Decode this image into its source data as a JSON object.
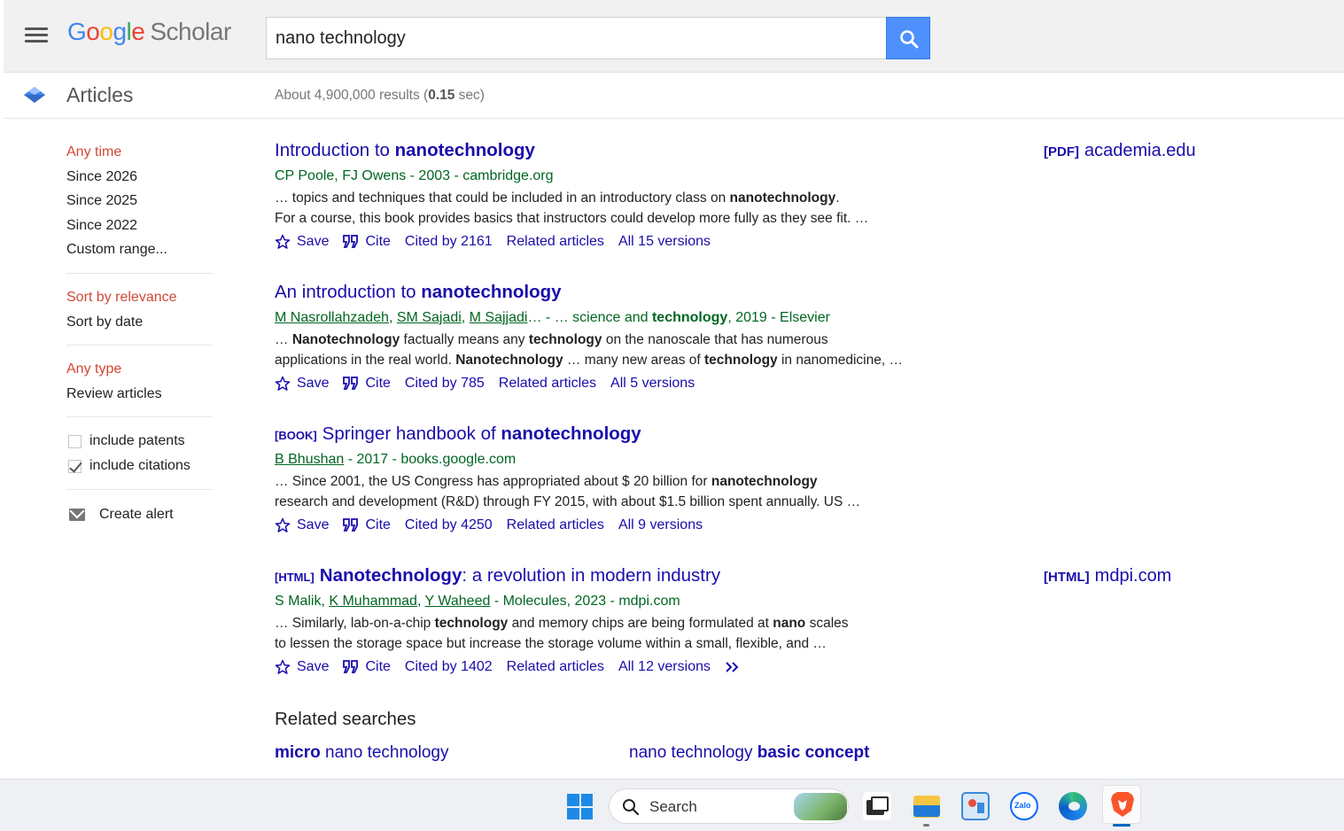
{
  "header": {
    "logo_letters": [
      "G",
      "o",
      "o",
      "g",
      "l",
      "e"
    ],
    "logo_suffix": "Scholar",
    "search_value": "nano technology"
  },
  "subheader": {
    "section": "Articles",
    "results_prefix": "About 4,900,000 results (",
    "results_time": "0.15",
    "results_suffix": " sec)"
  },
  "sidebar": {
    "time_items": [
      "Any time",
      "Since 2026",
      "Since 2025",
      "Since 2022",
      "Custom range..."
    ],
    "sort_items": [
      "Sort by relevance",
      "Sort by date"
    ],
    "type_items": [
      "Any type",
      "Review articles"
    ],
    "include_patents": "include patents",
    "include_citations": "include citations",
    "create_alert": "Create alert"
  },
  "results": [
    {
      "title_pre": "Introduction to ",
      "title_bold": "nanotechnology",
      "title_post": "",
      "tag": "",
      "authors_html": "CP Poole, FJ Owens - 2003 - cambridge.org",
      "snippet1": "… topics and techniques that could be included in an introductory class on <b>nanotechnology</b>.",
      "snippet2": "For a course, this book provides basics that instructors could develop more fully as they see fit. …",
      "cited": "Cited by 2161",
      "versions": "All 15 versions",
      "side_tag": "[PDF]",
      "side_domain": "academia.edu"
    },
    {
      "title_pre": "An introduction to ",
      "title_bold": "nanotechnology",
      "title_post": "",
      "tag": "",
      "authors_html": "<u>M Nasrollahzadeh</u>, <u>SM Sajadi</u>, <u>M Sajjadi</u>… - … science and <b>technology</b>, 2019 - Elsevier",
      "snippet1": "… <b>Nanotechnology</b> factually means any <b>technology</b> on the nanoscale that has numerous",
      "snippet2": "applications in the real world. <b>Nanotechnology</b> … many new areas of <b>technology</b> in nanomedicine, …",
      "cited": "Cited by 785",
      "versions": "All 5 versions",
      "side_tag": "",
      "side_domain": ""
    },
    {
      "title_pre": "Springer handbook of ",
      "title_bold": "nanotechnology",
      "title_post": "",
      "tag": "[BOOK]",
      "authors_html": "<u>B Bhushan</u> - 2017 - books.google.com",
      "snippet1": "… Since 2001, the US Congress has appropriated about $ 20 billion for <b>nanotechnology</b>",
      "snippet2": "research and development (R&amp;D) through FY 2015, with about $1.5 billion spent annually. US …",
      "cited": "Cited by 4250",
      "versions": "All 9 versions",
      "side_tag": "",
      "side_domain": ""
    },
    {
      "title_pre": "",
      "title_bold": "Nanotechnology",
      "title_post": ": a revolution in modern industry",
      "tag": "[HTML]",
      "authors_html": "S Malik, <u>K Muhammad</u>, <u>Y Waheed</u> - Molecules, 2023 - mdpi.com",
      "snippet1": "… Similarly, lab-on-a-chip <b>technology</b> and memory chips are being formulated at <b>nano</b> scales",
      "snippet2": "to lessen the storage space but increase the storage volume within a small, flexible, and …",
      "cited": "Cited by 1402",
      "versions": "All 12 versions",
      "side_tag": "[HTML]",
      "side_domain": "mdpi.com"
    }
  ],
  "actions": {
    "save": "Save",
    "cite": "Cite",
    "related": "Related articles"
  },
  "related_searches": {
    "title": "Related searches",
    "items": [
      {
        "bold": "micro",
        "rest": " nano technology",
        "bold_first": true
      },
      {
        "bold": "basic concept",
        "rest": "nano technology ",
        "bold_first": false
      }
    ]
  },
  "taskbar": {
    "search_label": "Search",
    "zalo_label": "Zalo"
  }
}
